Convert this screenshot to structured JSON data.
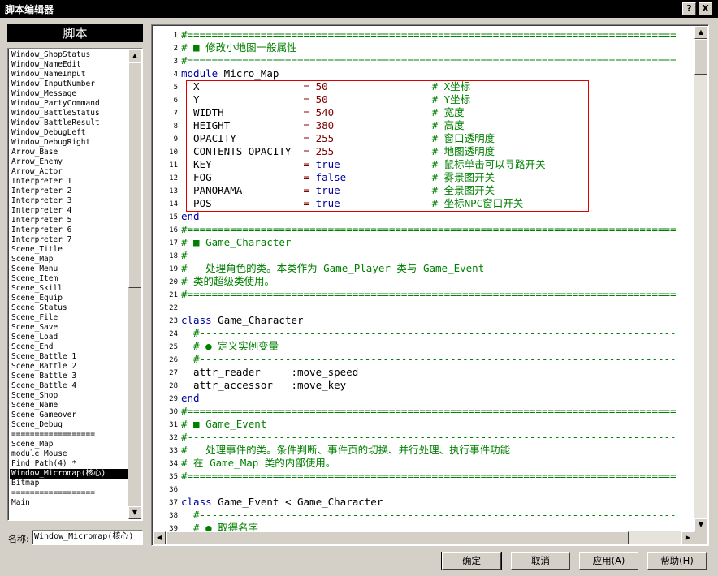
{
  "window": {
    "title": "脚本编辑器",
    "help_btn": "?",
    "close_btn": "X"
  },
  "sidebar": {
    "header": "脚本",
    "items": [
      "Window_ShopStatus",
      "Window_NameEdit",
      "Window_NameInput",
      "Window_InputNumber",
      "Window_Message",
      "Window_PartyCommand",
      "Window_BattleStatus",
      "Window_BattleResult",
      "Window_DebugLeft",
      "Window_DebugRight",
      "Arrow_Base",
      "Arrow_Enemy",
      "Arrow_Actor",
      "Interpreter 1",
      "Interpreter 2",
      "Interpreter 3",
      "Interpreter 4",
      "Interpreter 5",
      "Interpreter 6",
      "Interpreter 7",
      "Scene_Title",
      "Scene_Map",
      "Scene_Menu",
      "Scene_Item",
      "Scene_Skill",
      "Scene_Equip",
      "Scene_Status",
      "Scene_File",
      "Scene_Save",
      "Scene_Load",
      "Scene_End",
      "Scene_Battle 1",
      "Scene_Battle 2",
      "Scene_Battle 3",
      "Scene_Battle 4",
      "Scene_Shop",
      "Scene_Name",
      "Scene_Gameover",
      "Scene_Debug",
      "==================",
      "Scene_Map",
      "module Mouse",
      "Find Path(4) *",
      "Window_Micromap(核心)",
      "Bitmap",
      "==================",
      "Main"
    ],
    "selected_index": 43,
    "name_label": "名称:",
    "name_value": "Window_Micromap(核心)"
  },
  "editor": {
    "lines": [
      {
        "n": "1",
        "segs": [
          [
            "c",
            "#================================================================================"
          ]
        ]
      },
      {
        "n": "2",
        "segs": [
          [
            "c",
            "# ■ 修改小地图一般属性"
          ]
        ]
      },
      {
        "n": "3",
        "segs": [
          [
            "c",
            "#================================================================================"
          ]
        ]
      },
      {
        "n": "4",
        "segs": [
          [
            "k",
            "module"
          ],
          [
            "p",
            " Micro_Map"
          ]
        ]
      },
      {
        "n": "5",
        "segs": [
          [
            "p",
            "  X                 "
          ],
          [
            "n",
            "= 50"
          ],
          [
            "p",
            "                 "
          ],
          [
            "c",
            "# X坐标"
          ]
        ]
      },
      {
        "n": "6",
        "segs": [
          [
            "p",
            "  Y                 "
          ],
          [
            "n",
            "= 50"
          ],
          [
            "p",
            "                 "
          ],
          [
            "c",
            "# Y坐标"
          ]
        ]
      },
      {
        "n": "7",
        "segs": [
          [
            "p",
            "  WIDTH             "
          ],
          [
            "n",
            "= 540"
          ],
          [
            "p",
            "                "
          ],
          [
            "c",
            "# 宽度"
          ]
        ]
      },
      {
        "n": "8",
        "segs": [
          [
            "p",
            "  HEIGHT            "
          ],
          [
            "n",
            "= 380"
          ],
          [
            "p",
            "                "
          ],
          [
            "c",
            "# 高度"
          ]
        ]
      },
      {
        "n": "9",
        "segs": [
          [
            "p",
            "  OPACITY           "
          ],
          [
            "n",
            "= 255"
          ],
          [
            "p",
            "                "
          ],
          [
            "c",
            "# 窗口透明度"
          ]
        ]
      },
      {
        "n": "10",
        "segs": [
          [
            "p",
            "  CONTENTS_OPACITY  "
          ],
          [
            "n",
            "= 255"
          ],
          [
            "p",
            "                "
          ],
          [
            "c",
            "# 地图透明度"
          ]
        ]
      },
      {
        "n": "11",
        "segs": [
          [
            "p",
            "  KEY               "
          ],
          [
            "n",
            "= "
          ],
          [
            "k",
            "true"
          ],
          [
            "p",
            "               "
          ],
          [
            "c",
            "# 鼠标单击可以寻路开关"
          ]
        ]
      },
      {
        "n": "12",
        "segs": [
          [
            "p",
            "  FOG               "
          ],
          [
            "n",
            "= "
          ],
          [
            "k",
            "false"
          ],
          [
            "p",
            "              "
          ],
          [
            "c",
            "# 雾景图开关"
          ]
        ]
      },
      {
        "n": "13",
        "segs": [
          [
            "p",
            "  PANORAMA          "
          ],
          [
            "n",
            "= "
          ],
          [
            "k",
            "true"
          ],
          [
            "p",
            "               "
          ],
          [
            "c",
            "# 全景图开关"
          ]
        ]
      },
      {
        "n": "14",
        "segs": [
          [
            "p",
            "  POS               "
          ],
          [
            "n",
            "= "
          ],
          [
            "k",
            "true"
          ],
          [
            "p",
            "               "
          ],
          [
            "c",
            "# 坐标NPC窗口开关"
          ]
        ]
      },
      {
        "n": "15",
        "segs": [
          [
            "k",
            "end"
          ]
        ]
      },
      {
        "n": "16",
        "segs": [
          [
            "c",
            "#================================================================================"
          ]
        ]
      },
      {
        "n": "17",
        "segs": [
          [
            "c",
            "# ■ Game_Character"
          ]
        ]
      },
      {
        "n": "18",
        "segs": [
          [
            "c",
            "#--------------------------------------------------------------------------------"
          ]
        ]
      },
      {
        "n": "19",
        "segs": [
          [
            "c",
            "#   处理角色的类。本类作为 Game_Player 类与 Game_Event"
          ]
        ]
      },
      {
        "n": "20",
        "segs": [
          [
            "c",
            "# 类的超级类使用。"
          ]
        ]
      },
      {
        "n": "21",
        "segs": [
          [
            "c",
            "#================================================================================"
          ]
        ]
      },
      {
        "n": "22",
        "segs": [
          [
            "p",
            ""
          ]
        ]
      },
      {
        "n": "23",
        "segs": [
          [
            "k",
            "class"
          ],
          [
            "p",
            " Game_Character"
          ]
        ]
      },
      {
        "n": "24",
        "segs": [
          [
            "c",
            "  #------------------------------------------------------------------------------"
          ]
        ]
      },
      {
        "n": "25",
        "segs": [
          [
            "c",
            "  # ● 定义实例变量"
          ]
        ]
      },
      {
        "n": "26",
        "segs": [
          [
            "c",
            "  #------------------------------------------------------------------------------"
          ]
        ]
      },
      {
        "n": "27",
        "segs": [
          [
            "p",
            "  attr_reader     :move_speed"
          ]
        ]
      },
      {
        "n": "28",
        "segs": [
          [
            "p",
            "  attr_accessor   :move_key"
          ]
        ]
      },
      {
        "n": "29",
        "segs": [
          [
            "k",
            "end"
          ]
        ]
      },
      {
        "n": "30",
        "segs": [
          [
            "c",
            "#================================================================================"
          ]
        ]
      },
      {
        "n": "31",
        "segs": [
          [
            "c",
            "# ■ Game_Event"
          ]
        ]
      },
      {
        "n": "32",
        "segs": [
          [
            "c",
            "#--------------------------------------------------------------------------------"
          ]
        ]
      },
      {
        "n": "33",
        "segs": [
          [
            "c",
            "#   处理事件的类。条件判断、事件页的切换、并行处理、执行事件功能"
          ]
        ]
      },
      {
        "n": "34",
        "segs": [
          [
            "c",
            "# 在 Game_Map 类的内部使用。"
          ]
        ]
      },
      {
        "n": "35",
        "segs": [
          [
            "c",
            "#================================================================================"
          ]
        ]
      },
      {
        "n": "36",
        "segs": [
          [
            "p",
            ""
          ]
        ]
      },
      {
        "n": "37",
        "segs": [
          [
            "k",
            "class"
          ],
          [
            "p",
            " Game_Event < Game_Character"
          ]
        ]
      },
      {
        "n": "38",
        "segs": [
          [
            "c",
            "  #------------------------------------------------------------------------------"
          ]
        ]
      },
      {
        "n": "39",
        "segs": [
          [
            "c",
            "  # ● 取得名字"
          ]
        ]
      }
    ]
  },
  "buttons": {
    "ok": "确定",
    "cancel": "取消",
    "apply": "应用(A)",
    "help": "帮助(H)"
  },
  "colors": {
    "comment": "#008000",
    "number": "#800000",
    "keyword": "#0000a0",
    "highlight_box": "#e00000"
  }
}
